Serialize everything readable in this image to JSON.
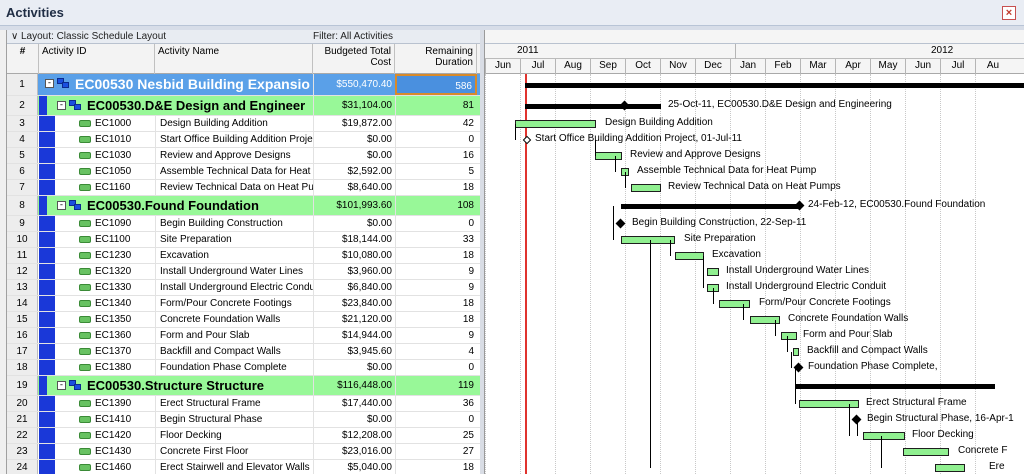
{
  "window": {
    "title": "Activities",
    "close_glyph": "×"
  },
  "layout_bar": {
    "layout_label": "Layout: Classic Schedule Layout",
    "filter_label": "Filter: All Activities"
  },
  "columns": {
    "num": "#",
    "activity_id": "Activity ID",
    "activity_name": "Activity Name",
    "budget_line1": "Budgeted Total",
    "budget_line2": "Cost",
    "dur_line1": "Remaining",
    "dur_line2": "Duration"
  },
  "timescale": {
    "year_left": "2011",
    "year_right": "2012",
    "months": [
      "Jun",
      "Jul",
      "Aug",
      "Sep",
      "Oct",
      "Nov",
      "Dec",
      "Jan",
      "Feb",
      "Mar",
      "Apr",
      "May",
      "Jun",
      "Jul",
      "Au"
    ]
  },
  "rows": [
    {
      "n": "1",
      "type": "wbs1",
      "label": "EC00530  Nesbid Building Expansio",
      "cost": "$550,470.40",
      "dur": "586"
    },
    {
      "n": "2",
      "type": "wbs2",
      "label": "EC00530.D&E  Design and Engineer",
      "cost": "$31,104.00",
      "dur": "81"
    },
    {
      "n": "3",
      "type": "act",
      "id": "EC1000",
      "name": "Design Building Addition",
      "cost": "$19,872.00",
      "dur": "42"
    },
    {
      "n": "4",
      "type": "act",
      "id": "EC1010",
      "name": "Start Office Building Addition Project",
      "cost": "$0.00",
      "dur": "0"
    },
    {
      "n": "5",
      "type": "act",
      "id": "EC1030",
      "name": "Review and Approve Designs",
      "cost": "$0.00",
      "dur": "16"
    },
    {
      "n": "6",
      "type": "act",
      "id": "EC1050",
      "name": "Assemble Technical Data for Heat P",
      "cost": "$2,592.00",
      "dur": "5"
    },
    {
      "n": "7",
      "type": "act",
      "id": "EC1160",
      "name": "Review Technical Data on Heat Pum",
      "cost": "$8,640.00",
      "dur": "18"
    },
    {
      "n": "8",
      "type": "wbs2",
      "label": "EC00530.Found  Foundation",
      "cost": "$101,993.60",
      "dur": "108"
    },
    {
      "n": "9",
      "type": "act",
      "id": "EC1090",
      "name": "Begin Building Construction",
      "cost": "$0.00",
      "dur": "0"
    },
    {
      "n": "10",
      "type": "act",
      "id": "EC1100",
      "name": "Site Preparation",
      "cost": "$18,144.00",
      "dur": "33"
    },
    {
      "n": "11",
      "type": "act",
      "id": "EC1230",
      "name": "Excavation",
      "cost": "$10,080.00",
      "dur": "18"
    },
    {
      "n": "12",
      "type": "act",
      "id": "EC1320",
      "name": "Install Underground Water Lines",
      "cost": "$3,960.00",
      "dur": "9"
    },
    {
      "n": "13",
      "type": "act",
      "id": "EC1330",
      "name": "Install Underground Electric Conduit",
      "cost": "$6,840.00",
      "dur": "9"
    },
    {
      "n": "14",
      "type": "act",
      "id": "EC1340",
      "name": "Form/Pour Concrete Footings",
      "cost": "$23,840.00",
      "dur": "18"
    },
    {
      "n": "15",
      "type": "act",
      "id": "EC1350",
      "name": "Concrete Foundation Walls",
      "cost": "$21,120.00",
      "dur": "18"
    },
    {
      "n": "16",
      "type": "act",
      "id": "EC1360",
      "name": "Form and Pour Slab",
      "cost": "$14,944.00",
      "dur": "9"
    },
    {
      "n": "17",
      "type": "act",
      "id": "EC1370",
      "name": "Backfill and Compact Walls",
      "cost": "$3,945.60",
      "dur": "4"
    },
    {
      "n": "18",
      "type": "act",
      "id": "EC1380",
      "name": "Foundation Phase Complete",
      "cost": "$0.00",
      "dur": "0"
    },
    {
      "n": "19",
      "type": "wbs2",
      "label": "EC00530.Structure  Structure",
      "cost": "$116,448.00",
      "dur": "119"
    },
    {
      "n": "20",
      "type": "act",
      "id": "EC1390",
      "name": "Erect Structural Frame",
      "cost": "$17,440.00",
      "dur": "36"
    },
    {
      "n": "21",
      "type": "act",
      "id": "EC1410",
      "name": "Begin Structural Phase",
      "cost": "$0.00",
      "dur": "0"
    },
    {
      "n": "22",
      "type": "act",
      "id": "EC1420",
      "name": "Floor Decking",
      "cost": "$12,208.00",
      "dur": "25"
    },
    {
      "n": "23",
      "type": "act",
      "id": "EC1430",
      "name": "Concrete First Floor",
      "cost": "$23,016.00",
      "dur": "27"
    },
    {
      "n": "24",
      "type": "act",
      "id": "EC1460",
      "name": "Erect Stairwell and Elevator Walls",
      "cost": "$5,040.00",
      "dur": "18"
    }
  ],
  "gantt_labels": {
    "r2": "25-Oct-11, EC00530.D&E  Design and Engineering",
    "r3": "Design Building Addition",
    "r4": "Start Office Building Addition Project, 01-Jul-11",
    "r5": "Review and Approve Designs",
    "r6": "Assemble Technical Data for Heat Pump",
    "r7": "Review Technical Data on Heat Pumps",
    "r8": "24-Feb-12, EC00530.Found  Foundation",
    "r9": "Begin Building Construction, 22-Sep-11",
    "r10": "Site Preparation",
    "r11": "Excavation",
    "r12": "Install Underground Water Lines",
    "r13": "Install Underground Electric Conduit",
    "r14": "Form/Pour Concrete Footings",
    "r15": "Concrete Foundation Walls",
    "r16": "Form and Pour Slab",
    "r17": "Backfill and Compact Walls",
    "r18": "Foundation Phase Complete,",
    "r20": "Erect Structural Frame",
    "r21": "Begin Structural Phase, 16-Apr-1",
    "r22": "Floor Decking",
    "r23": "Concrete F",
    "r24": "Ere"
  },
  "colors": {
    "wbs1": "#5aa0e8",
    "wbs2": "#98f898",
    "activity_bar": "#90f090",
    "data_date_line": "#e0332e"
  }
}
